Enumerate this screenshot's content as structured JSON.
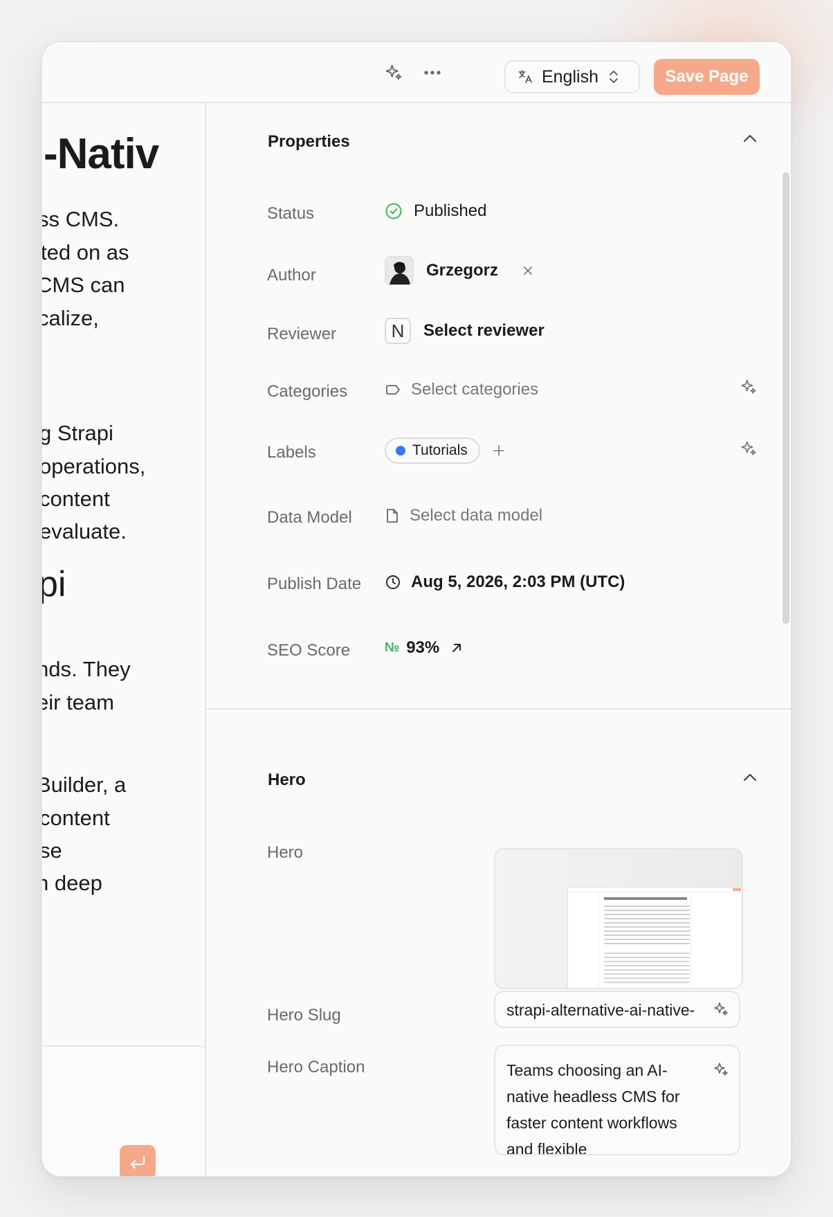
{
  "topbar": {
    "language": "English",
    "save_label": "Save Page"
  },
  "editor": {
    "lines": [
      "-Nativ",
      "ss CMS.",
      "ted on as",
      "CMS can",
      "calize,",
      "g Strapi",
      " operations,",
      "content",
      "evaluate.",
      "pi",
      "nds. They",
      "eir team",
      "Builder, a",
      " content",
      "se",
      "n deep"
    ]
  },
  "properties": {
    "title": "Properties",
    "status_label": "Status",
    "status_value": "Published",
    "author_label": "Author",
    "author_value": "Grzegorz",
    "reviewer_label": "Reviewer",
    "reviewer_initial": "N",
    "reviewer_value": "Select reviewer",
    "categories_label": "Categories",
    "categories_placeholder": "Select categories",
    "labels_label": "Labels",
    "label_chip": "Tutorials",
    "data_model_label": "Data Model",
    "data_model_placeholder": "Select data model",
    "publish_date_label": "Publish Date",
    "publish_date_value": "Aug 5, 2026, 2:03 PM (UTC)",
    "seo_label": "SEO Score",
    "seo_prefix": "№",
    "seo_value": "93%"
  },
  "hero": {
    "title": "Hero",
    "hero_label": "Hero",
    "slug_label": "Hero Slug",
    "slug_value": "strapi-alternative-ai-native-",
    "caption_label": "Hero Caption",
    "caption_value": "Teams choosing an AI-native headless CMS for faster content workflows and flexible"
  },
  "colors": {
    "accent": "#f5a98a",
    "success": "#3fb15b",
    "chip_dot": "#3877f2"
  }
}
